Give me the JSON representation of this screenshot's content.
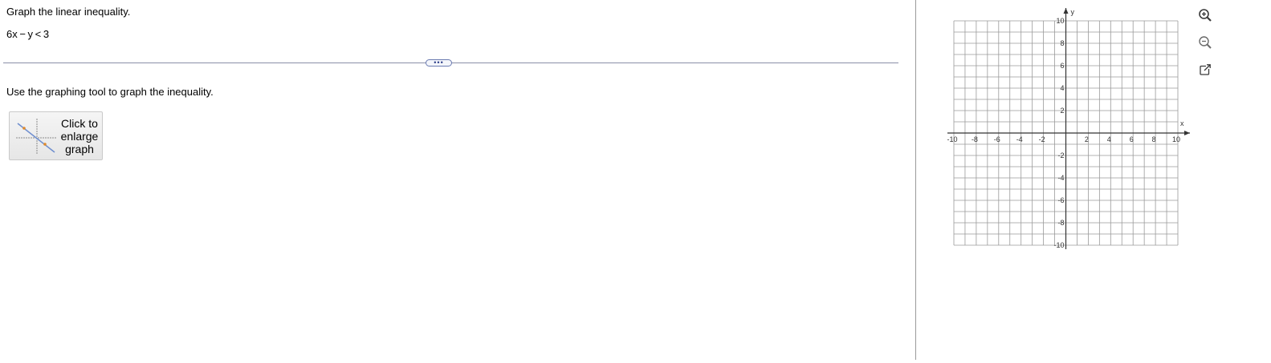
{
  "problem": {
    "title": "Graph the linear inequality.",
    "inequality": "6x − y < 3"
  },
  "divider": {
    "handle_label": "•••"
  },
  "instruction": "Use the graphing tool to graph the inequality.",
  "enlarge_button": {
    "line1": "Click to",
    "line2": "enlarge",
    "line3": "graph"
  },
  "graph": {
    "x_axis_label": "x",
    "y_axis_label": "y",
    "x_range": [
      -10,
      10
    ],
    "y_range": [
      -10,
      10
    ],
    "grid_step": 1,
    "x_tick_labels": [
      "-10",
      "-8",
      "-6",
      "-4",
      "-2",
      "2",
      "4",
      "6",
      "8",
      "10"
    ],
    "y_tick_labels": [
      "10",
      "8",
      "6",
      "4",
      "2",
      "-2",
      "-4",
      "-6",
      "-8",
      "-10"
    ]
  },
  "toolbar": {
    "zoom_in_icon": "zoom-in-icon",
    "zoom_out_icon": "zoom-out-icon",
    "popout_icon": "external-link-icon"
  },
  "colors": {
    "divider": "#8a8fa8",
    "handle_border": "#6a7ab0",
    "grid": "#9a9a9a",
    "axis": "#333333",
    "icon": "#3a3a3a"
  }
}
